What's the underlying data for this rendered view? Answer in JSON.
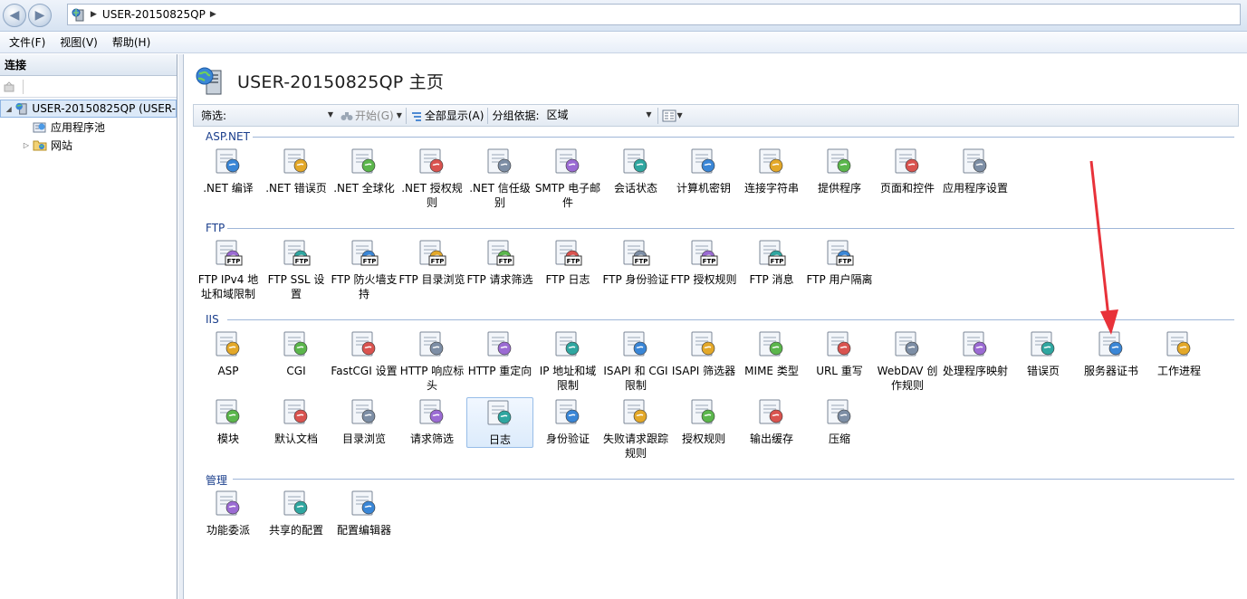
{
  "address": {
    "path": "USER-20150825QP"
  },
  "menu": [
    "文件(F)",
    "视图(V)",
    "帮助(H)"
  ],
  "connections": {
    "title": "连接",
    "tree": [
      {
        "label": "USER-20150825QP (USER-",
        "level": 0,
        "expander": "◢"
      },
      {
        "label": "应用程序池",
        "level": 1,
        "expander": ""
      },
      {
        "label": "网站",
        "level": 1,
        "expander": "▷"
      }
    ]
  },
  "page": {
    "title": "USER-20150825QP 主页"
  },
  "filterbar": {
    "filter_label": "筛选:",
    "filter_value": "",
    "go_label": "开始(G)",
    "show_all_label": "全部显示(A)",
    "group_label": "分组依据:",
    "group_value": "区域"
  },
  "sections": [
    {
      "name": "ASP.NET",
      "items": [
        ".NET 编译",
        ".NET 错误页",
        ".NET 全球化",
        ".NET 授权规则",
        ".NET 信任级别",
        "SMTP 电子邮件",
        "会话状态",
        "计算机密钥",
        "连接字符串",
        "提供程序",
        "页面和控件",
        "应用程序设置"
      ]
    },
    {
      "name": "FTP",
      "items": [
        "FTP IPv4 地址和域限制",
        "FTP SSL 设置",
        "FTP 防火墙支持",
        "FTP 目录浏览",
        "FTP 请求筛选",
        "FTP 日志",
        "FTP 身份验证",
        "FTP 授权规则",
        "FTP 消息",
        "FTP 用户隔离"
      ]
    },
    {
      "name": "IIS",
      "items": [
        "ASP",
        "CGI",
        "FastCGI 设置",
        "HTTP 响应标头",
        "HTTP 重定向",
        "IP 地址和域限制",
        "ISAPI 和 CGI 限制",
        "ISAPI 筛选器",
        "MIME 类型",
        "URL 重写",
        "WebDAV 创作规则",
        "处理程序映射",
        "错误页",
        "服务器证书",
        "工作进程",
        "模块",
        "默认文档",
        "目录浏览",
        "请求筛选",
        "日志",
        "身份验证",
        "失败请求跟踪规则",
        "授权规则",
        "输出缓存",
        "压缩"
      ]
    },
    {
      "name": "管理",
      "items": [
        "功能委派",
        "共享的配置",
        "配置编辑器"
      ]
    }
  ],
  "selected_item": "日志",
  "colors": {
    "accent": "#1a3e8c",
    "arrow": "#e8323a"
  }
}
